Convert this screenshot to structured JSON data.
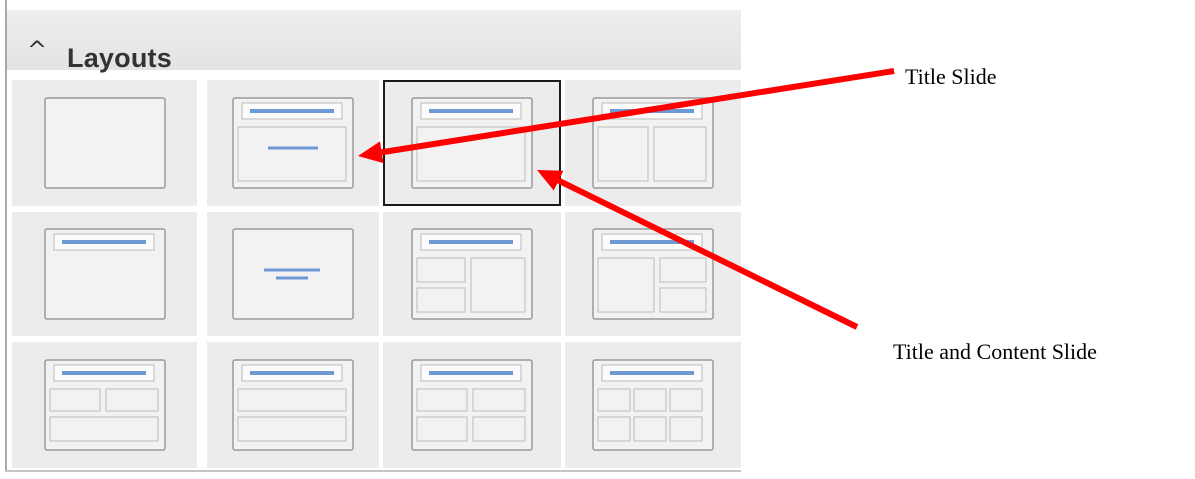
{
  "panel": {
    "title": "Layouts",
    "expander_icon": "chevron-up-icon",
    "colors": {
      "cell_bg": "#ececec",
      "thumb_fill": "#f2f2f2",
      "thumb_border": "#9a9a9a",
      "placeholder_border": "#c8c8c8",
      "title_bar": "#6f99d6",
      "selected_border": "#1a1a1a"
    },
    "layouts": [
      {
        "variant": "blank",
        "selected": false
      },
      {
        "variant": "title-slide",
        "selected": false
      },
      {
        "variant": "title-content",
        "selected": true
      },
      {
        "variant": "title-2-content",
        "selected": false
      },
      {
        "variant": "title-only",
        "selected": false
      },
      {
        "variant": "centered-text",
        "selected": false
      },
      {
        "variant": "title-2-content-left-split",
        "selected": false
      },
      {
        "variant": "title-2-content-right-split",
        "selected": false
      },
      {
        "variant": "title-2-top-1-bottom",
        "selected": false
      },
      {
        "variant": "title-2-stacked",
        "selected": false
      },
      {
        "variant": "title-4-content",
        "selected": false
      },
      {
        "variant": "title-6-content",
        "selected": false
      }
    ]
  },
  "annotations": {
    "title_slide_label": "Title Slide",
    "title_content_label": "Title and Content Slide",
    "arrow_color": "#ff0000"
  }
}
